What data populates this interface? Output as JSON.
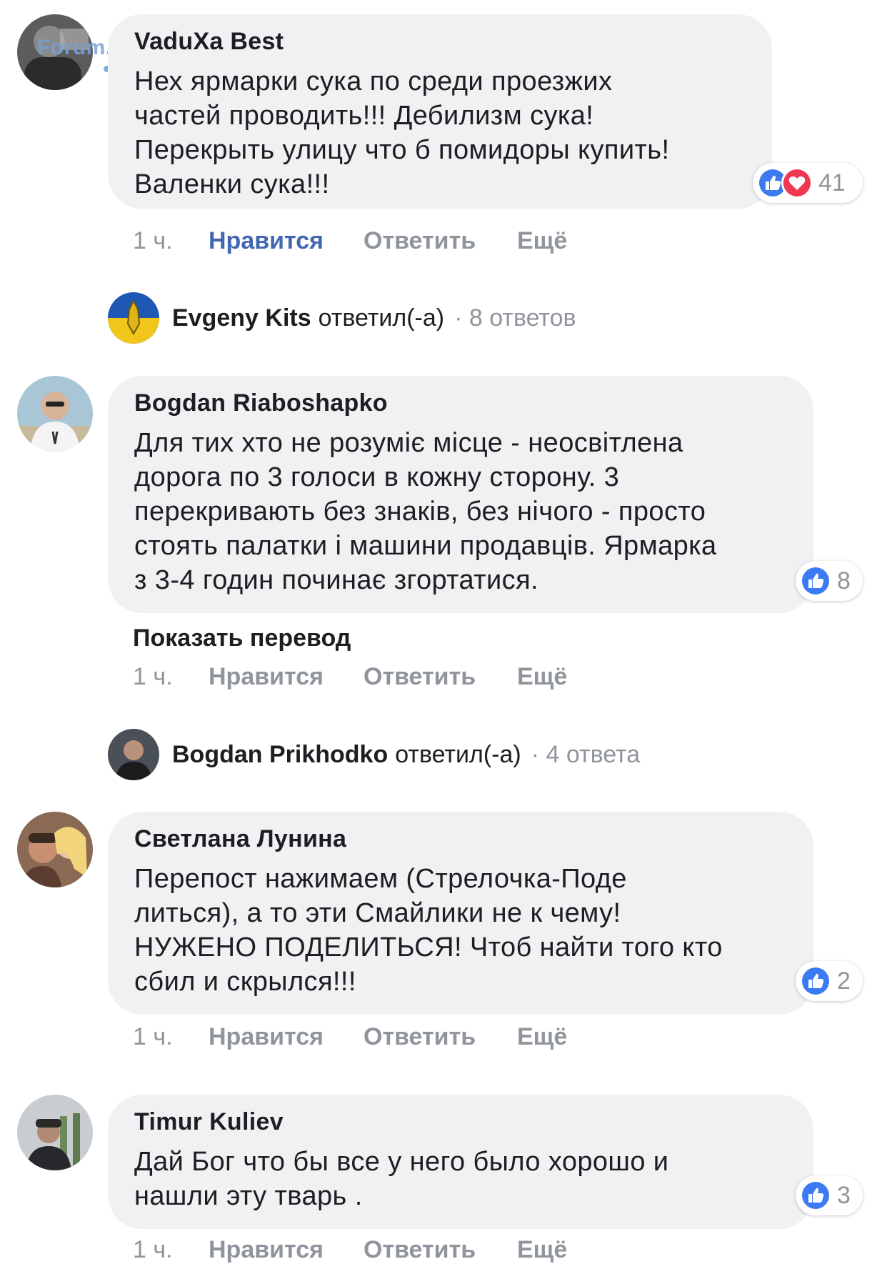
{
  "watermark": "Forum.Donik.ua",
  "actions_labels": {
    "like": "Нравится",
    "reply": "Ответить",
    "more": "Ещё"
  },
  "translate_label": "Показать перевод",
  "comments": [
    {
      "author": "VaduXa Best",
      "text_lines": [
        "Нех ярмарки сука по среди проезжих",
        "частей проводить!!! Дебилизм сука!",
        "Перекрыть улицу что б помидоры купить!",
        "Валенки сука!!!"
      ],
      "time": "1 ч.",
      "reaction_count": "41",
      "reaction_icons": [
        "like-icon",
        "love-icon"
      ],
      "liked": true
    },
    {
      "author": "Bogdan Riaboshapko",
      "text_lines": [
        "Для тих хто не розуміє місце - неосвітлена",
        "дорога по 3 голоси в кожну сторону. 3",
        "перекривають без знаків, без нічого - просто",
        "стоять палатки і машини продавців. Ярмарка",
        "з 3-4 годин починає згортатися."
      ],
      "time": "1 ч.",
      "reaction_count": "8",
      "reaction_icons": [
        "like-icon"
      ],
      "liked": false
    },
    {
      "author": "Светлана Лунина",
      "text_lines": [
        "Перепост нажимаем (Стрелочка-Поде",
        "литься), а то эти Смайлики не к чему!",
        "НУЖЕНО ПОДЕЛИТЬСЯ! Чтоб найти того кто",
        "сбил и скрылся!!!"
      ],
      "time": "1 ч.",
      "reaction_count": "2",
      "reaction_icons": [
        "like-icon"
      ],
      "liked": false
    },
    {
      "author": "Timur Kuliev",
      "text_lines": [
        "Дай Бог что бы все у него было хорошо и",
        "нашли эту тварь ."
      ],
      "time": "1 ч.",
      "reaction_count": "3",
      "reaction_icons": [
        "like-icon"
      ],
      "liked": false
    }
  ],
  "reply_threads": [
    {
      "name": "Evgeny Kits",
      "verb": "ответил(-а)",
      "count": "· 8 ответов"
    },
    {
      "name": "Bogdan Prikhodko",
      "verb": "ответил(-а)",
      "count": "· 4 ответа"
    }
  ],
  "colors": {
    "bubble": "#f0f1f3",
    "like_blue": "#4267b2",
    "reaction_blue": "#3b7af0",
    "love_red": "#f0384f",
    "meta_gray": "#90949c"
  }
}
